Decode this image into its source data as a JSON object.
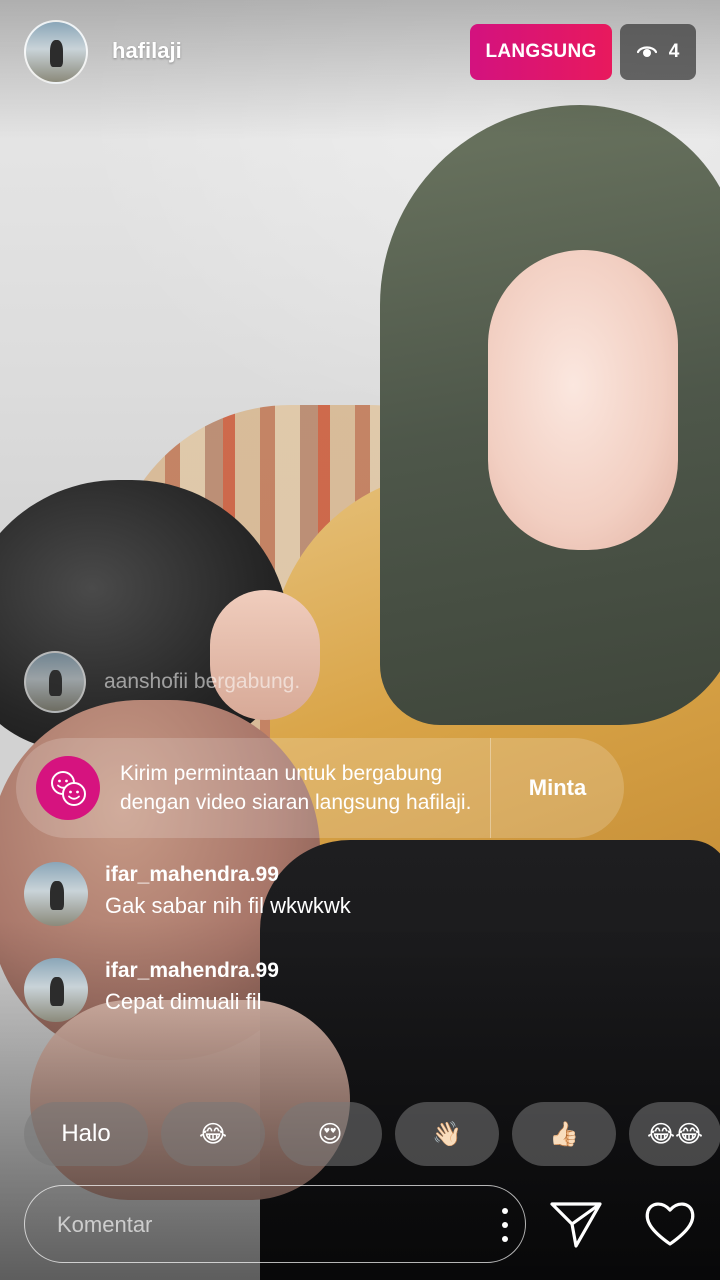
{
  "header": {
    "host_username": "hafilaji",
    "live_label": "LANGSUNG",
    "viewer_count": "4"
  },
  "join_notice": {
    "text": "aanshofii bergabung."
  },
  "request_card": {
    "text": "Kirim permintaan untuk bergabung dengan video siaran langsung hafilaji.",
    "button_label": "Minta"
  },
  "comments": [
    {
      "username": "ifar_mahendra.99",
      "text": "Gak sabar nih fil wkwkwk"
    },
    {
      "username": "ifar_mahendra.99",
      "text": "Cepat dimuali fil"
    }
  ],
  "quick_replies": [
    "Halo",
    "😂",
    "😍",
    "👋🏻",
    "👍🏻",
    "😂😂"
  ],
  "composer": {
    "placeholder": "Komentar"
  },
  "colors": {
    "live_badge": "#d3127f",
    "viewer_badge": "#3c3c3c",
    "request_icon": "#d6137f"
  },
  "icons": {
    "viewer": "eye-icon",
    "request": "faces-icon",
    "more": "more-vertical-icon",
    "send": "send-icon",
    "like": "heart-icon"
  }
}
